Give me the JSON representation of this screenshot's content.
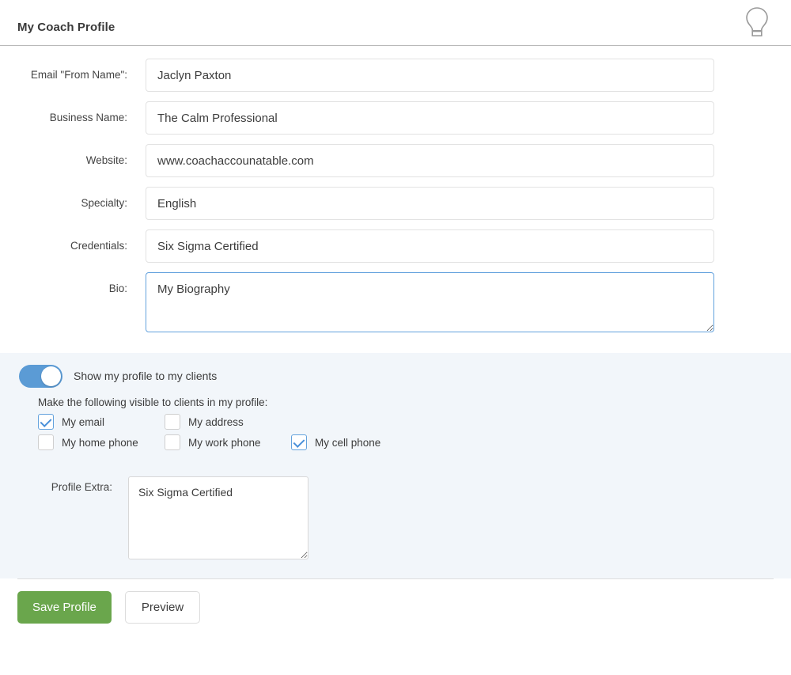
{
  "header": {
    "title": "My Coach Profile",
    "bulb_icon": "lightbulb-icon"
  },
  "form": {
    "fields": [
      {
        "label": "Email \"From Name\":",
        "value": "Jaclyn Paxton",
        "placeholder": ""
      },
      {
        "label": "Business Name:",
        "value": "The Calm Professional",
        "placeholder": ""
      },
      {
        "label": "Website:",
        "value": "www.coachaccounatable.com",
        "placeholder": ""
      },
      {
        "label": "Specialty:",
        "value": "English",
        "placeholder": ""
      },
      {
        "label": "Credentials:",
        "value": "Six Sigma Certified",
        "placeholder": ""
      }
    ],
    "bio": {
      "label": "Bio:",
      "value": "My Biography",
      "placeholder": ""
    }
  },
  "visibility_panel": {
    "toggle": {
      "label": "Show my profile to my clients",
      "on": true
    },
    "checkbox_intro": "Make the following visible to clients in my profile:",
    "checkboxes": [
      {
        "label": "My email",
        "checked": true
      },
      {
        "label": "My address",
        "checked": false
      },
      {
        "label": "My cell phone",
        "checked": true
      },
      {
        "label": "My home phone",
        "checked": false
      },
      {
        "label": "My work phone",
        "checked": false
      }
    ],
    "profile_extra": {
      "label": "Profile Extra:",
      "value": "Six Sigma Certified",
      "placeholder": ""
    }
  },
  "footer": {
    "save_label": "Save Profile",
    "preview_label": "Preview"
  },
  "colors": {
    "accent_blue": "#5b9bd5",
    "save_green": "#6aa64c",
    "panel_bg": "#f2f6fa",
    "focus_border": "#63a2dd"
  }
}
